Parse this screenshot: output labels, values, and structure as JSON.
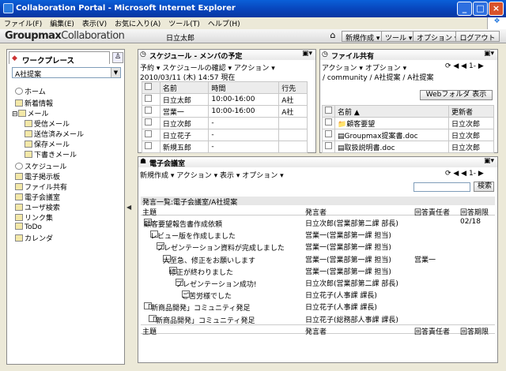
{
  "window": {
    "title": "Collaboration Portal - Microsoft Internet Explorer",
    "min": "_",
    "max": "□",
    "close": "×"
  },
  "menu": [
    "ファイル(F)",
    "編集(E)",
    "表示(V)",
    "お気に入り(A)",
    "ツール(T)",
    "ヘルプ(H)"
  ],
  "header": {
    "logo_bold": "Groupmax",
    "logo_light": "Collaboration",
    "user": "日立太郎",
    "new": "新規作成 ▾",
    "tools": "ツール ▾",
    "options": "オプション ▾",
    "logout": "ログアウト"
  },
  "workplace": {
    "tab": "ワークプレース",
    "select": "A社提案",
    "items": [
      "ホーム",
      "新着情報",
      "メール",
      "受信メール",
      "送信済みメール",
      "保存メール",
      "下書きメール",
      "スケジュール",
      "電子掲示板",
      "ファイル共有",
      "電子会議室",
      "ユーザ検索",
      "リンク集",
      "ToDo",
      "カレンダ"
    ]
  },
  "schedule": {
    "title": "スケジュール - メンバの予定",
    "toolbar": "予約 ▾  スケジュールの確認 ▾  アクション ▾",
    "now": "2010/03/11 (木) 14:57  現在",
    "headers": [
      "名前",
      "時間",
      "行先"
    ],
    "rows": [
      [
        "日立太郎",
        "10:00-16:00",
        "A社"
      ],
      [
        "営業一",
        "10:00-16:00",
        "A社"
      ],
      [
        "日立次郎",
        "-",
        ""
      ],
      [
        "日立花子",
        "-",
        ""
      ],
      [
        "新規五郎",
        "-",
        ""
      ]
    ]
  },
  "files": {
    "title": "ファイル共有",
    "toolbar": "アクション ▾  オプション ▾",
    "pager": "1-",
    "path": "/ community / A社提案 / A社提案",
    "webfolder": "Webフォルダ 表示",
    "headers": [
      "名前 ▲",
      "更新者"
    ],
    "rows": [
      [
        "顧客要望",
        "日立次郎"
      ],
      [
        "Groupmax提案書.doc",
        "日立次郎"
      ],
      [
        "取扱説明書.doc",
        "日立次郎"
      ]
    ]
  },
  "conf": {
    "title": "電子会議室",
    "toolbar": "新規作成 ▾  アクション ▾  表示 ▾  オプション ▾",
    "pager": "1-",
    "search": "検索",
    "list_title": "発言一覧:電子会議室/A社提案",
    "headers": [
      "主題",
      "発言者",
      "回答責任者",
      "回答期限"
    ],
    "rows": [
      {
        "subject": "顧客要望報告書作成依頼",
        "author": "日立次郎(営業部第二課 部長)",
        "resp": "",
        "due": "02/18"
      },
      {
        "subject": "レビュー版を作成しました",
        "author": "営業一(営業部第一課 担当)",
        "resp": "",
        "due": ""
      },
      {
        "subject": "プレゼンテーション資料が完成しました",
        "author": "営業一(営業部第一課 担当)",
        "resp": "",
        "due": ""
      },
      {
        "subject": "大至急、修正をお願いします",
        "author": "営業一(営業部第一課 担当)",
        "resp": "営業一",
        "due": ""
      },
      {
        "subject": "修正が終わりました",
        "author": "営業一(営業部第一課 担当)",
        "resp": "",
        "due": ""
      },
      {
        "subject": "プレゼンテーション成功!",
        "author": "日立次郎(営業部第二課 部長)",
        "resp": "",
        "due": ""
      },
      {
        "subject": "ご苦労様でした",
        "author": "日立花子(人事課 課長)",
        "resp": "",
        "due": ""
      },
      {
        "subject": "「新商品開発」コミュニティ発足",
        "author": "日立花子(人事課 課長)",
        "resp": "",
        "due": ""
      },
      {
        "subject": "「新商品開発」コミュニティ発足",
        "author": "日立花子(総務部人事課 課長)",
        "resp": "",
        "due": ""
      }
    ]
  }
}
